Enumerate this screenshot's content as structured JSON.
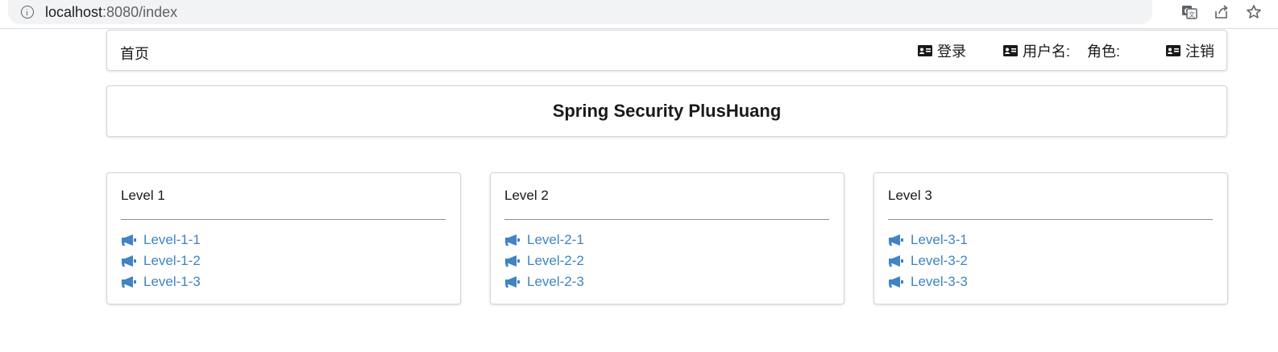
{
  "browser": {
    "url_host": "localhost",
    "url_rest": ":8080/index",
    "icons": [
      "info-icon",
      "translate-icon",
      "share-icon",
      "star-icon"
    ]
  },
  "nav": {
    "home": "首页",
    "login": "登录",
    "username": "用户名:",
    "role": "角色:",
    "logout": "注销",
    "icon": "id-card-icon"
  },
  "title": "Spring Security PlusHuang",
  "levels": [
    {
      "header": "Level 1",
      "links": [
        "Level-1-1",
        "Level-1-2",
        "Level-1-3"
      ]
    },
    {
      "header": "Level 2",
      "links": [
        "Level-2-1",
        "Level-2-2",
        "Level-2-3"
      ]
    },
    {
      "header": "Level 3",
      "links": [
        "Level-3-1",
        "Level-3-2",
        "Level-3-3"
      ]
    }
  ],
  "colors": {
    "link": "#4183c4",
    "text": "#1a1a1a",
    "border": "#d4d4d5"
  },
  "link_icon": "bullhorn-icon"
}
